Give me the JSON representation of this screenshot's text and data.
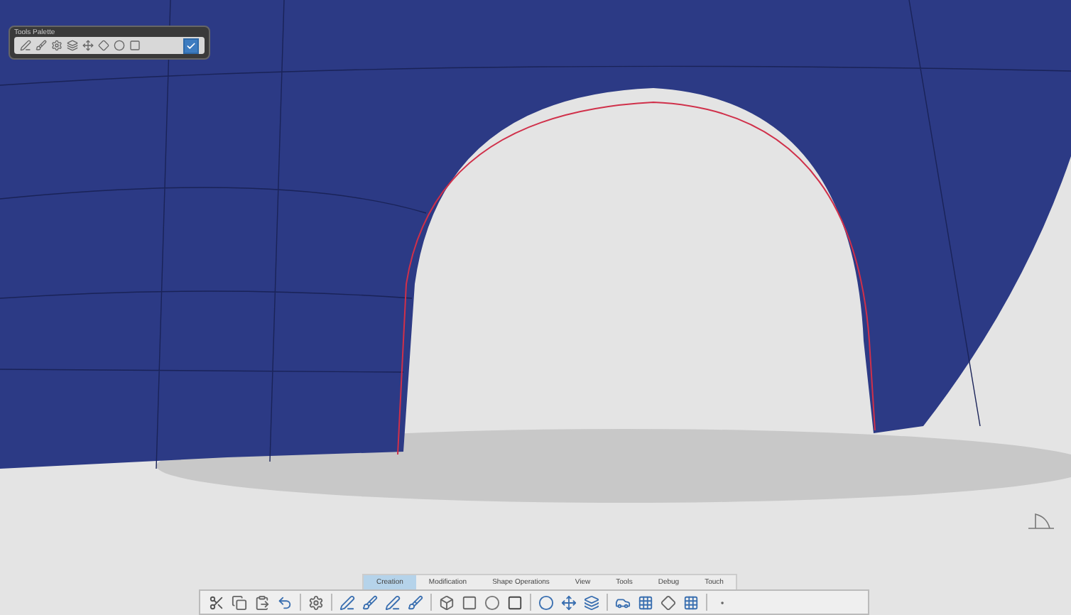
{
  "tools_palette": {
    "title": "Tools Palette",
    "checkbox_checked": true
  },
  "tabs": [
    {
      "label": "Creation",
      "selected": true
    },
    {
      "label": "Modification",
      "selected": false
    },
    {
      "label": "Shape Operations",
      "selected": false
    },
    {
      "label": "View",
      "selected": false
    },
    {
      "label": "Tools",
      "selected": false
    },
    {
      "label": "Debug",
      "selected": false
    },
    {
      "label": "Touch",
      "selected": false
    }
  ]
}
